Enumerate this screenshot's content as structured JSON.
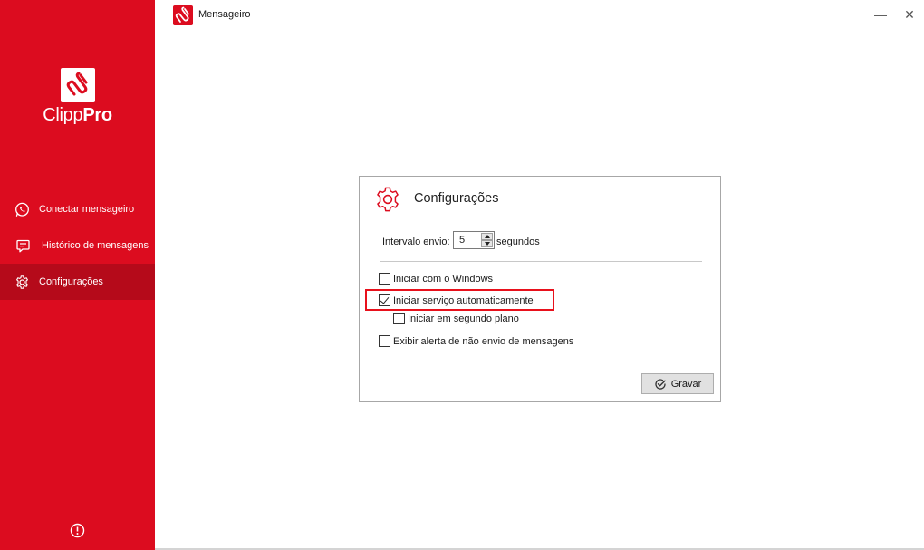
{
  "brand": {
    "name_regular": "Clipp",
    "name_bold": "Pro",
    "accent_color": "#dc0c1f"
  },
  "sidebar": {
    "items": [
      {
        "label": "Conectar mensageiro",
        "icon": "whatsapp-icon"
      },
      {
        "label": "Histórico de mensagens",
        "icon": "message-icon"
      },
      {
        "label": "Configurações",
        "icon": "gear-icon",
        "active": true
      }
    ],
    "footer_icon": "info-icon"
  },
  "window": {
    "title": "Mensageiro",
    "minimize_glyph": "—",
    "close_glyph": "✕"
  },
  "dialog": {
    "title": "Configurações",
    "interval_label": "Intervalo envio:",
    "interval_value": "5",
    "interval_unit": "segundos",
    "options": {
      "start_windows": {
        "label": "Iniciar com o Windows",
        "checked": false
      },
      "auto_service": {
        "label": "Iniciar serviço automaticamente",
        "checked": true
      },
      "background": {
        "label": "Iniciar em segundo plano",
        "checked": false
      },
      "alert": {
        "label": "Exibir alerta de não envio de mensagens",
        "checked": false
      }
    },
    "save_label": "Gravar"
  }
}
